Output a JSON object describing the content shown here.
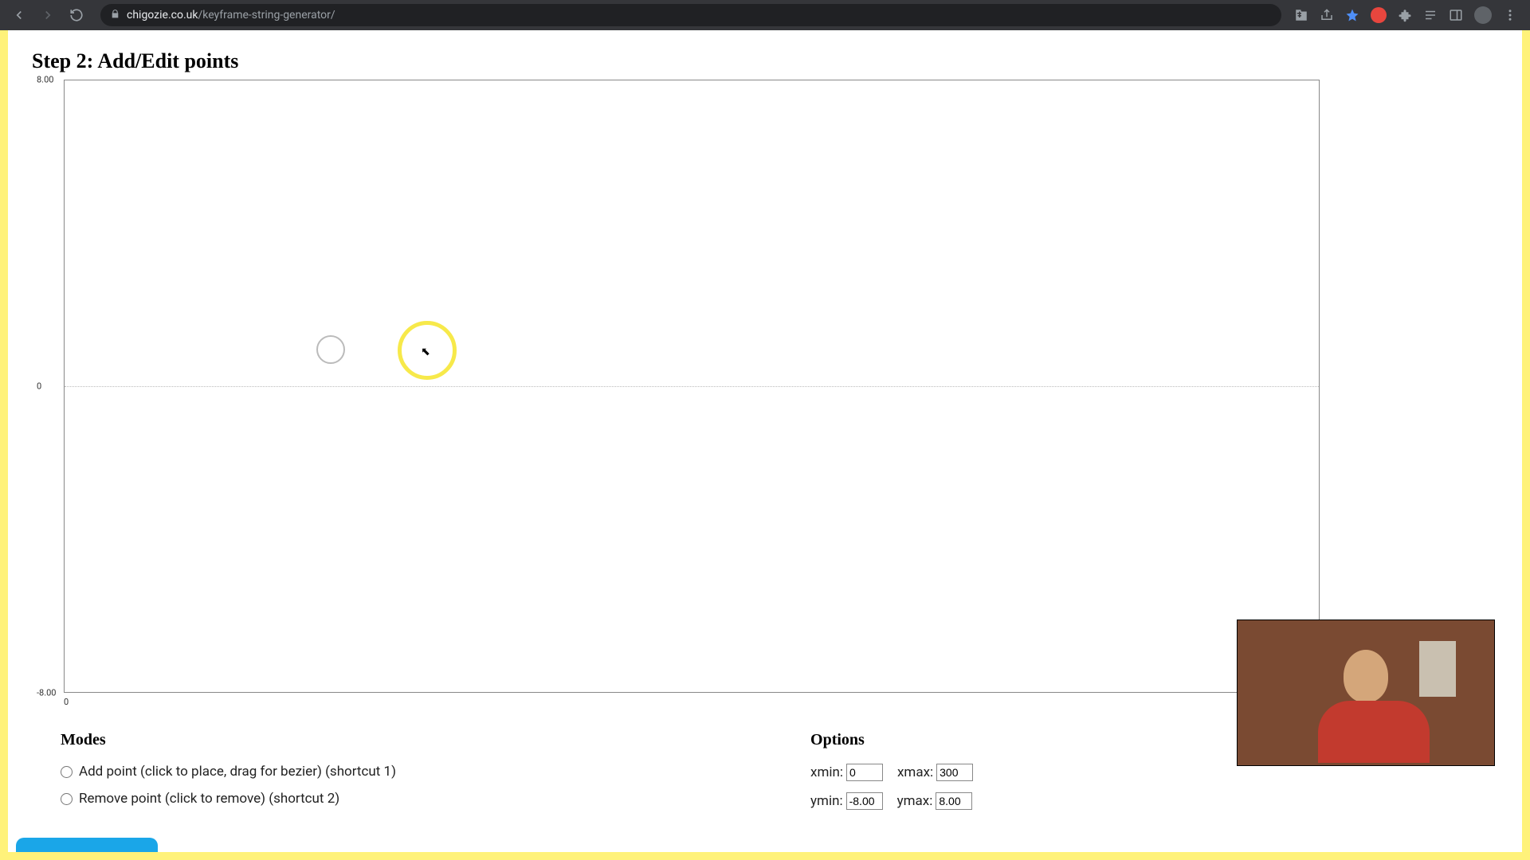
{
  "browser": {
    "url_domain": "chigozie.co.uk",
    "url_path": "/keyframe-string-generator/"
  },
  "page": {
    "heading": "Step 2: Add/Edit points"
  },
  "graph": {
    "y_top": "8.00",
    "y_mid": "0",
    "y_bot": "-8.00",
    "x_origin": "0"
  },
  "modes": {
    "title": "Modes",
    "add": "Add point (click to place, drag for bezier) (shortcut 1)",
    "remove": "Remove point (click to remove) (shortcut 2)"
  },
  "options": {
    "title": "Options",
    "xmin_label": "xmin:",
    "xmin": "0",
    "xmax_label": "xmax:",
    "xmax": "300",
    "ymin_label": "ymin:",
    "ymin": "-8.00",
    "ymax_label": "ymax:",
    "ymax": "8.00"
  }
}
